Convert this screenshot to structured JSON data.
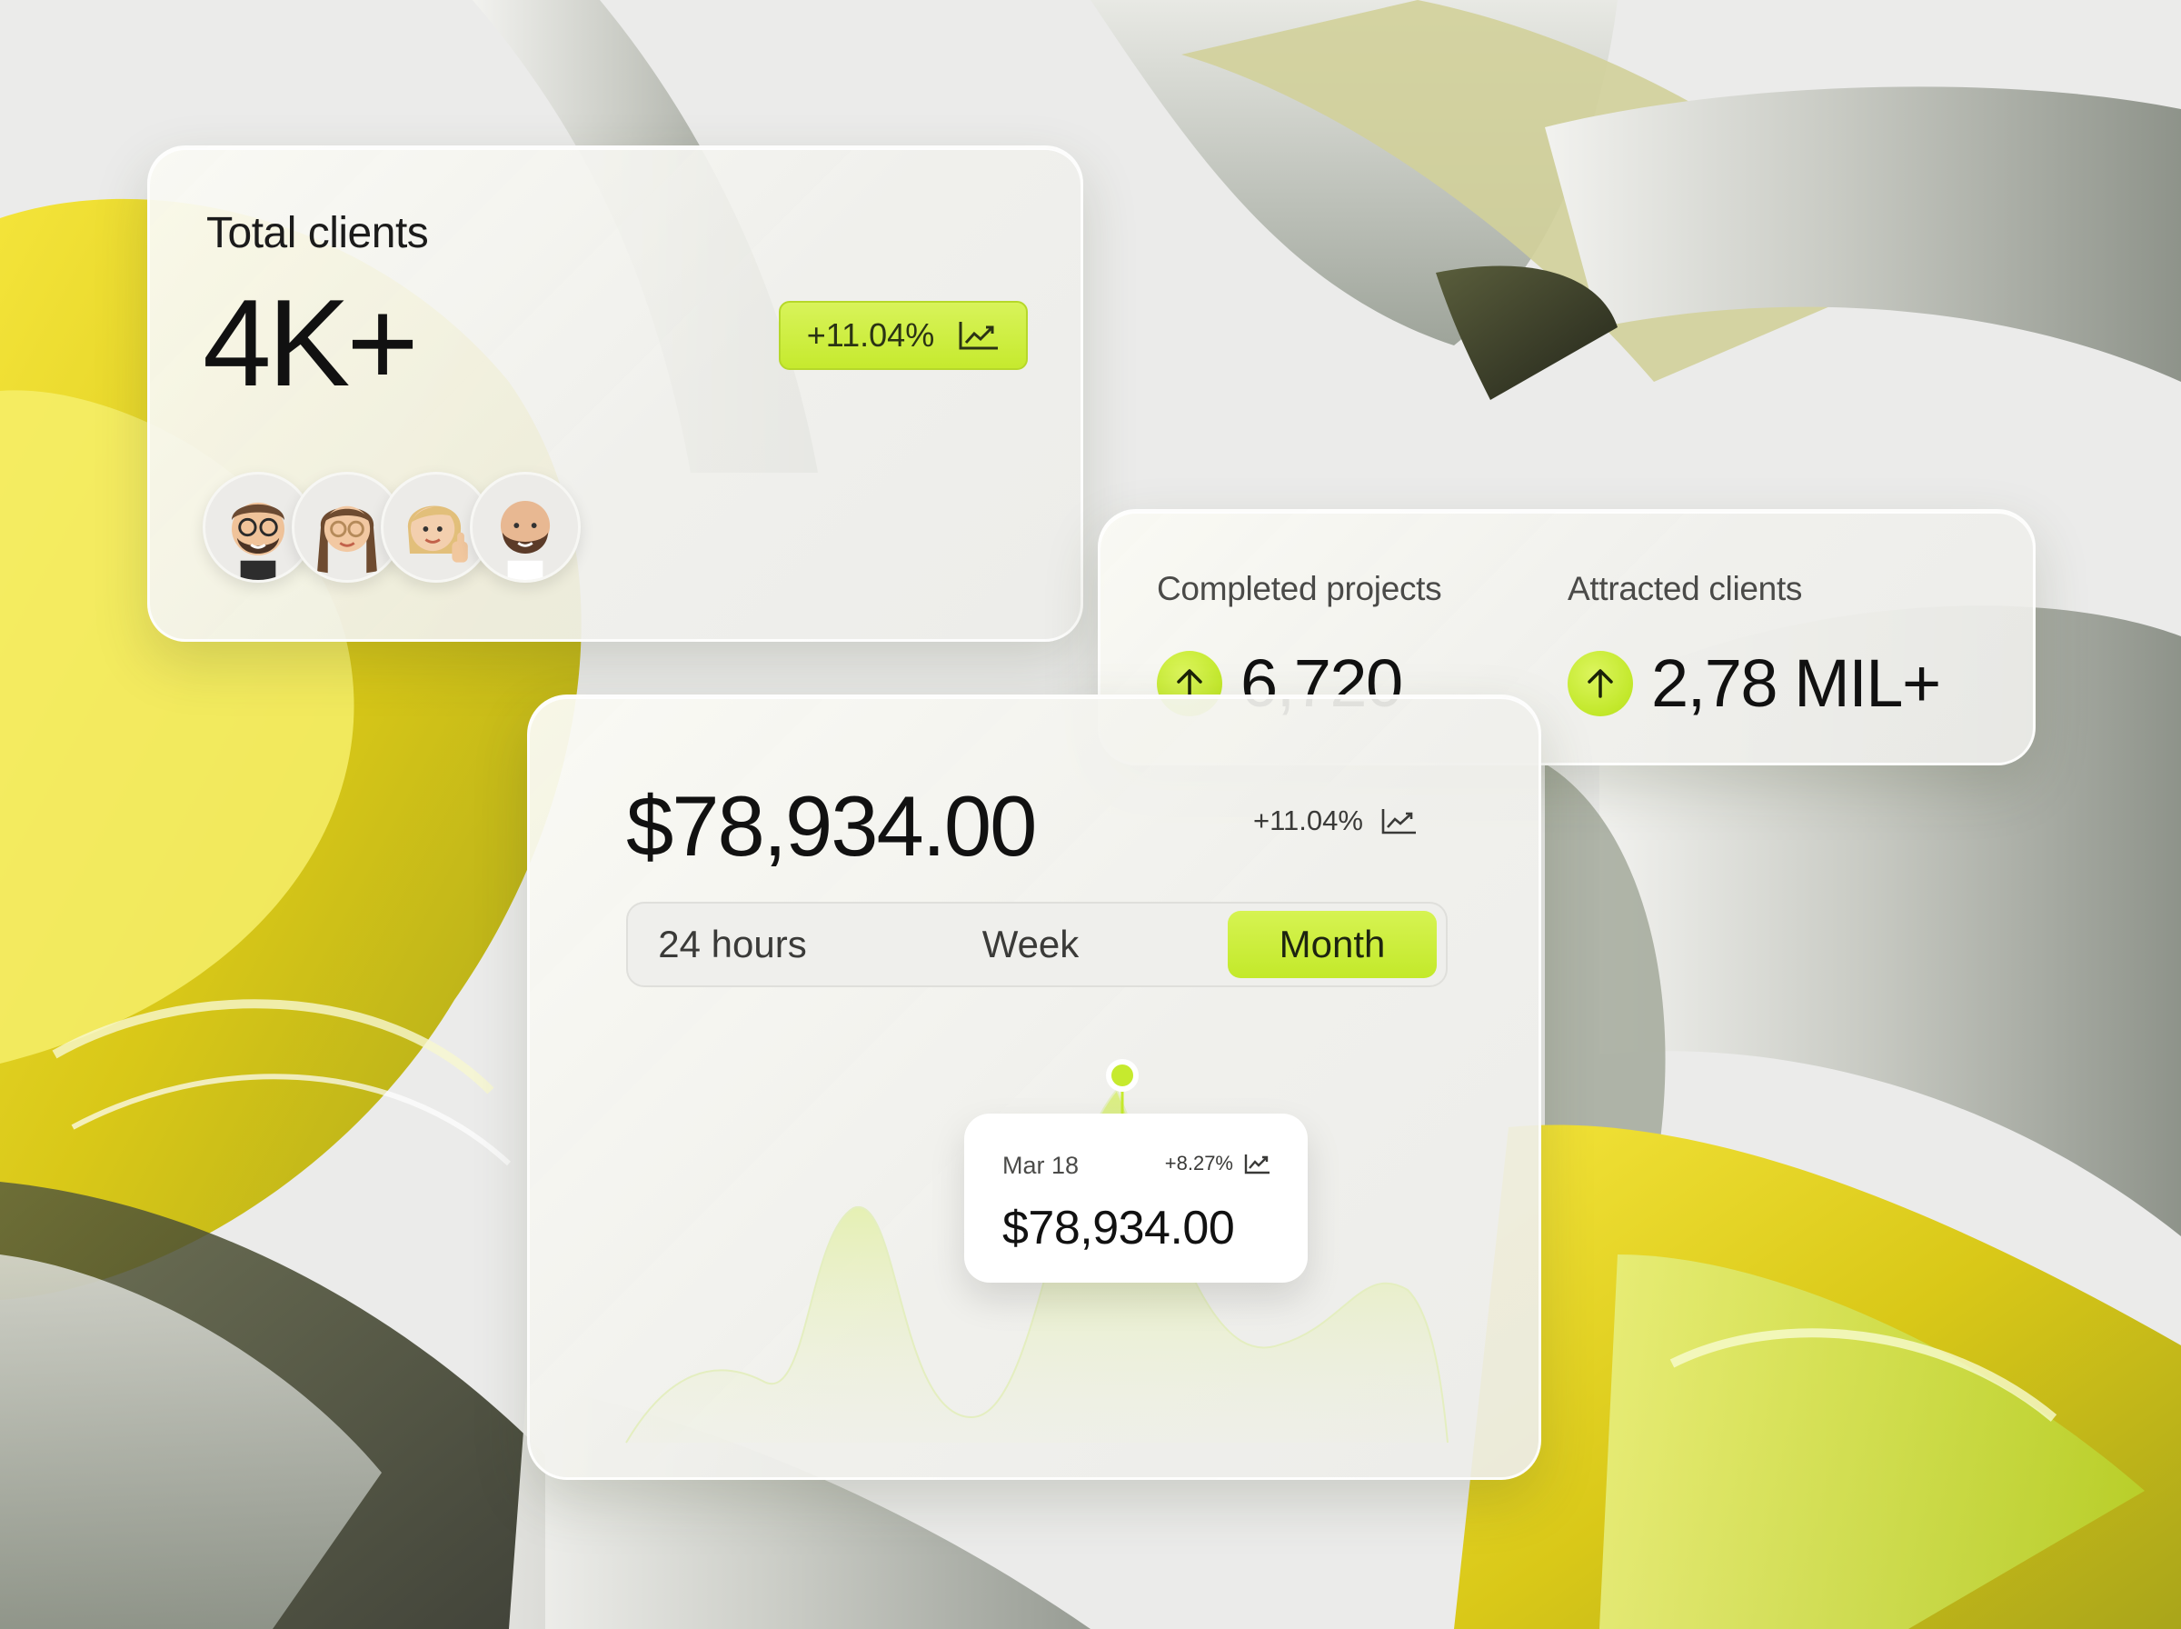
{
  "total_clients": {
    "label": "Total clients",
    "value": "4K+",
    "change": "+11.04%",
    "avatars": [
      "avatar-man-glasses",
      "avatar-woman-braids",
      "avatar-woman-thumbsup",
      "avatar-man-bald"
    ]
  },
  "stats": {
    "completed_projects": {
      "label": "Completed projects",
      "value": "6,720"
    },
    "attracted_clients": {
      "label": "Attracted clients",
      "value": "2,78 MIL+"
    }
  },
  "revenue": {
    "amount": "$78,934.00",
    "change": "+11.04%",
    "periods": [
      "24 hours",
      "Week",
      "Month"
    ],
    "selected_period": "Month",
    "tooltip": {
      "date": "Mar 18",
      "change": "+8.27%",
      "amount": "$78,934.00"
    }
  },
  "colors": {
    "accent_green": "#c6ea2e",
    "accent_green_light": "#dcf55e",
    "text_dark": "#111111",
    "card_bg": "#f0f0ec"
  }
}
